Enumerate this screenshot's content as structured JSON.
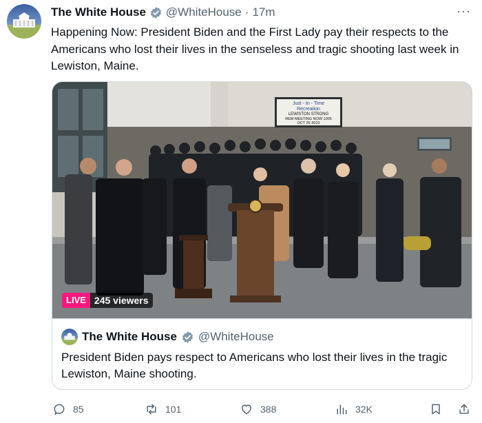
{
  "tweet": {
    "display_name": "The White House",
    "handle": "@WhiteHouse",
    "separator": "·",
    "time": "17m",
    "more_label": "···",
    "text": "Happening Now: President Biden and the First Lady pay their respects to the Americans who lost their lives in the senseless and tragic shooting last week in Lewiston, Maine.",
    "verified_color": "#829aab"
  },
  "video": {
    "live_label": "LIVE",
    "viewers": "245 viewers",
    "live_color": "#f91880",
    "sign_lines": [
      "Just - In - Time",
      "Recreation",
      "LEWISTON STRONG",
      "REM MEETING NOW 1005",
      "OCT 25 2023"
    ]
  },
  "quote": {
    "display_name": "The White House",
    "handle": "@WhiteHouse",
    "text": "President Biden pays respect to Americans who lost their lives in the tragic Lewiston, Maine shooting."
  },
  "actions": {
    "replies": "85",
    "reposts": "101",
    "likes": "388",
    "views": "32K"
  }
}
